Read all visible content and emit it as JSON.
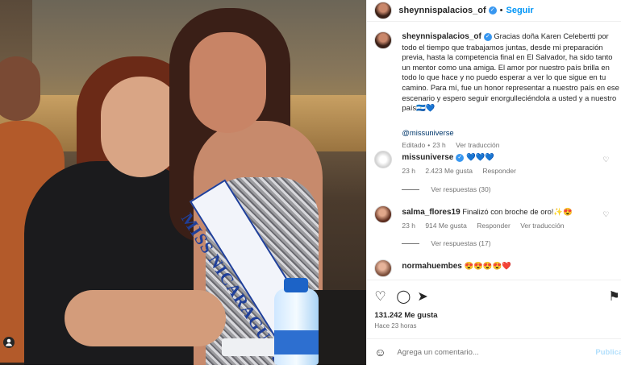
{
  "post_header": {
    "username": "sheynnispalacios_of",
    "follow_label": "Seguir",
    "separator": "•",
    "verified_icon": "✓"
  },
  "photo": {
    "sash_text": "MISS NICARAGUA 20",
    "user_tag_icon": "person-icon"
  },
  "caption": {
    "username": "sheynnispalacios_of",
    "text": "Gracias doña Karen Celebertti por todo el tiempo que trabajamos juntas, desde mi preparación previa, hasta la competencia final en El Salvador, ha sido tanto un mentor como una amiga. El amor por nuestro país brilla en todo lo que hace y no puedo esperar a ver lo que sigue en tu camino. Para mí, fue un honor representar a nuestro país en ese escenario y espero seguir enorgulleciéndola a usted y a nuestro país🇳🇮💙",
    "mention": "@missuniverse",
    "status": "Editado",
    "time": "23 h",
    "translate": "Ver traducción"
  },
  "comments": [
    {
      "username": "missuniverse",
      "text": "💙💙💙",
      "time": "23 h",
      "likes": "2.423 Me gusta",
      "reply": "Responder",
      "translate": "",
      "replies": "Ver respuestas (30)"
    },
    {
      "username": "salma_flores19",
      "text": "Finalizó con broche de oro!✨😍",
      "time": "23 h",
      "likes": "914 Me gusta",
      "reply": "Responder",
      "translate": "Ver traducción",
      "replies": "Ver respuestas (17)"
    },
    {
      "username": "normahuembes",
      "text": "😍😍😍😍❤️",
      "time": "",
      "likes": "",
      "reply": "",
      "translate": "",
      "replies": ""
    }
  ],
  "actions": {
    "like_icon": "♡",
    "comment_icon": "◯",
    "share_icon": "➤",
    "save_icon": "⚑",
    "likes_count": "131.242 Me gusta",
    "posted_ago": "Hace 23 horas"
  },
  "add_comment": {
    "emoji_icon": "☺",
    "placeholder": "Agrega un comentario...",
    "publish_label": "Publica"
  },
  "colors": {
    "link": "#0095f6",
    "verified": "#3897f0",
    "muted": "#737373"
  }
}
